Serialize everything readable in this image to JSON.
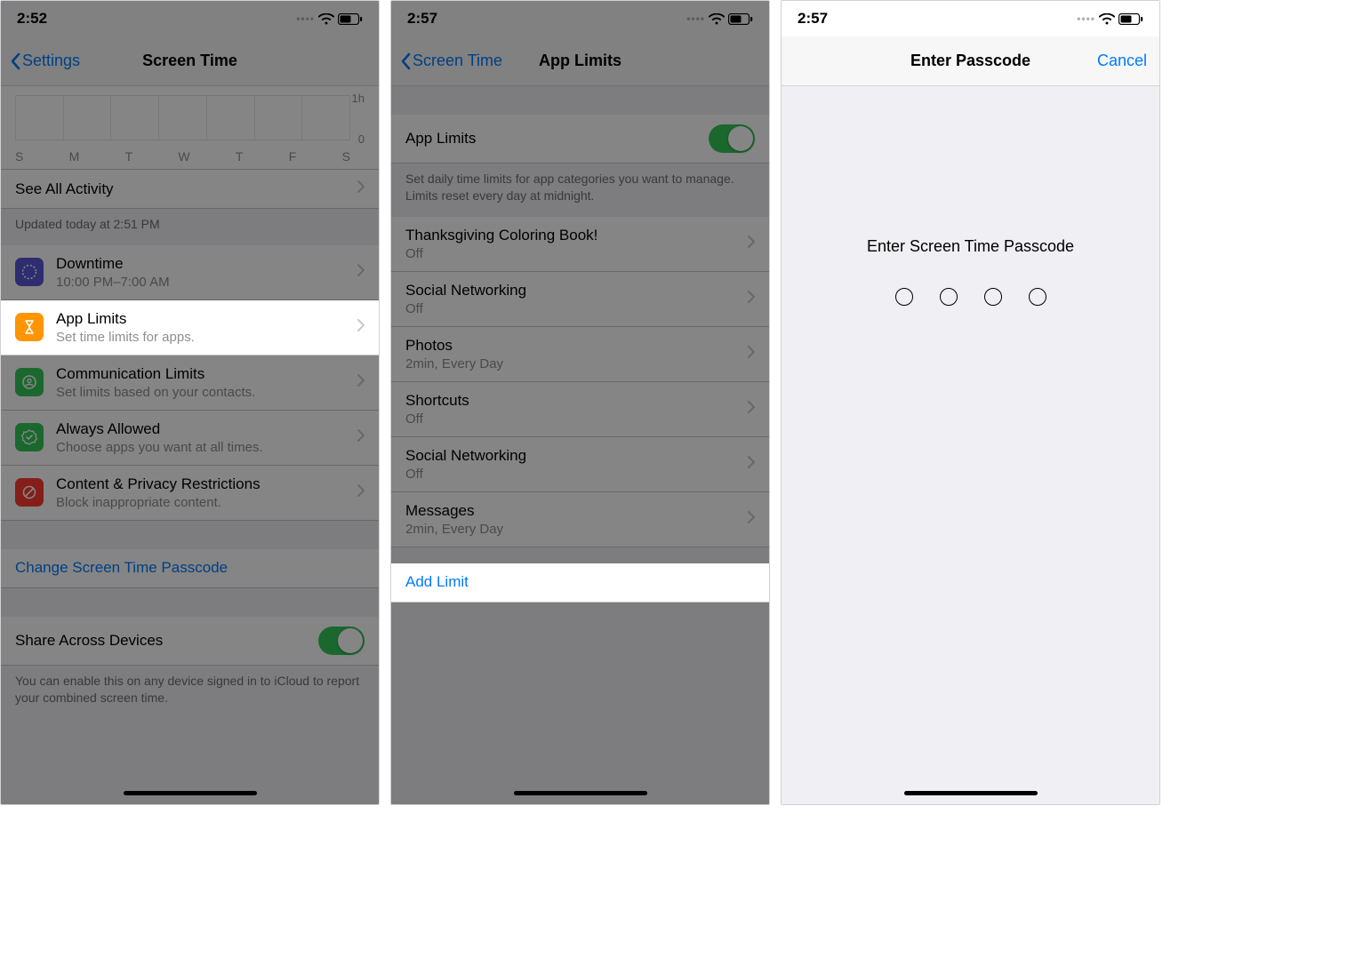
{
  "screen1": {
    "time": "2:52",
    "back": "Settings",
    "title": "Screen Time",
    "chart": {
      "label_1h": "1h",
      "label_0": "0",
      "days": [
        "S",
        "M",
        "T",
        "W",
        "T",
        "F",
        "S"
      ]
    },
    "see_all": {
      "label": "See All Activity"
    },
    "updated": "Updated today at 2:51 PM",
    "items": [
      {
        "title": "Downtime",
        "subtitle": "10:00 PM–7:00 AM",
        "icon_color": "#5856d6"
      },
      {
        "title": "App Limits",
        "subtitle": "Set time limits for apps.",
        "icon_color": "#ff9500"
      },
      {
        "title": "Communication Limits",
        "subtitle": "Set limits based on your contacts.",
        "icon_color": "#34c759"
      },
      {
        "title": "Always Allowed",
        "subtitle": "Choose apps you want at all times.",
        "icon_color": "#34c759"
      },
      {
        "title": "Content & Privacy Restrictions",
        "subtitle": "Block inappropriate content.",
        "icon_color": "#ff3b30"
      }
    ],
    "change_passcode": "Change Screen Time Passcode",
    "share_across": "Share Across Devices",
    "share_footer": "You can enable this on any device signed in to iCloud to report your combined screen time."
  },
  "screen2": {
    "time": "2:57",
    "back": "Screen Time",
    "title": "App Limits",
    "toggle_label": "App Limits",
    "toggle_footer": "Set daily time limits for app categories you want to manage. Limits reset every day at midnight.",
    "limits": [
      {
        "title": "Thanksgiving Coloring Book!",
        "sub": "Off"
      },
      {
        "title": "Social Networking",
        "sub": "Off"
      },
      {
        "title": "Photos",
        "sub": "2min, Every Day"
      },
      {
        "title": "Shortcuts",
        "sub": "Off"
      },
      {
        "title": "Social Networking",
        "sub": "Off"
      },
      {
        "title": "Messages",
        "sub": "2min, Every Day"
      }
    ],
    "add_limit": "Add Limit"
  },
  "screen3": {
    "time": "2:57",
    "title": "Enter Passcode",
    "cancel": "Cancel",
    "prompt": "Enter Screen Time Passcode"
  }
}
